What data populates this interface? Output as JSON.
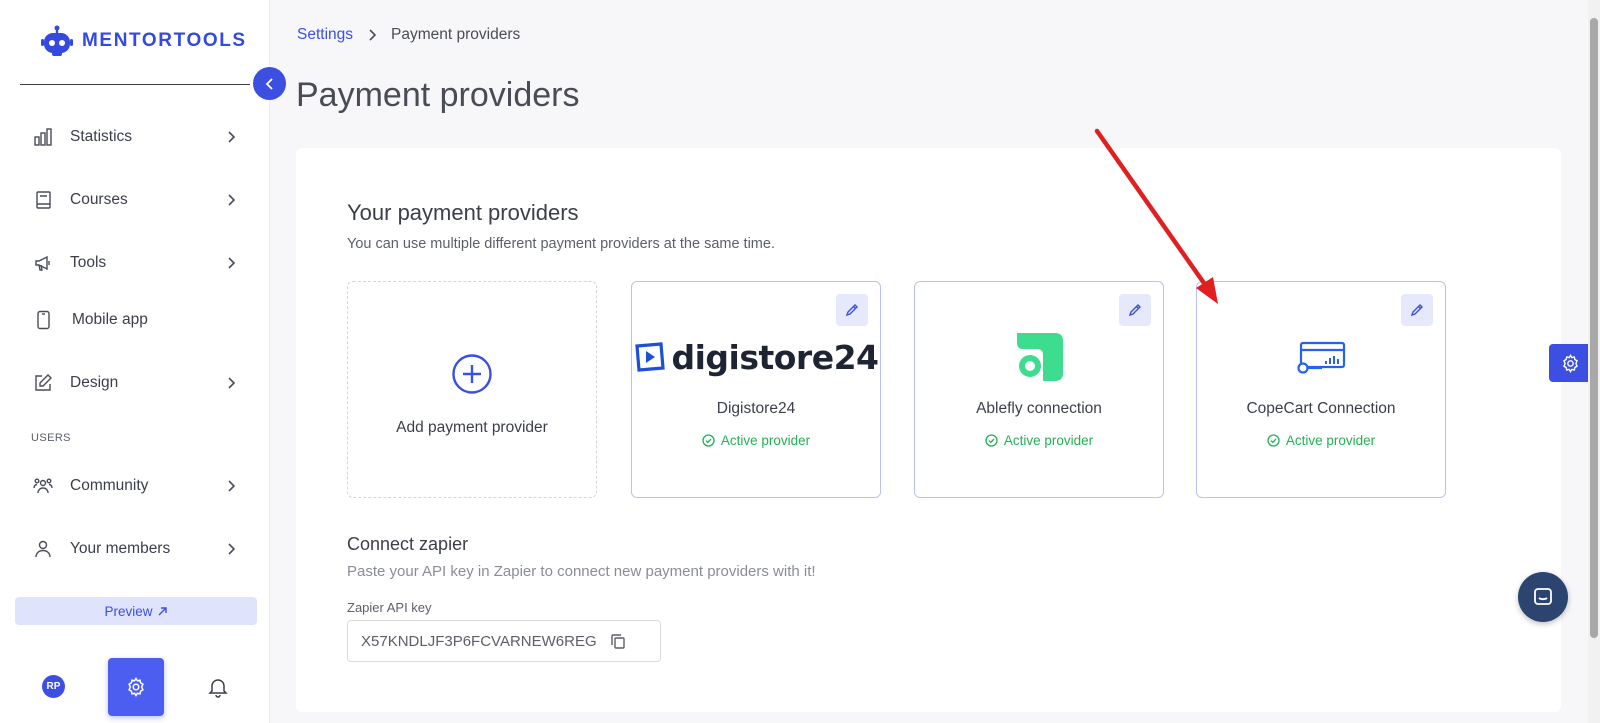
{
  "app": {
    "logo_text": "MENTORTOOLS"
  },
  "sidebar": {
    "items": [
      {
        "label": "Statistics"
      },
      {
        "label": "Courses"
      },
      {
        "label": "Tools"
      },
      {
        "label": "Mobile app"
      },
      {
        "label": "Design"
      },
      {
        "label": "Community"
      },
      {
        "label": "Your members"
      }
    ],
    "section_users": "USERS",
    "preview_label": "Preview",
    "avatar_initials": "RP"
  },
  "breadcrumb": {
    "parent": "Settings",
    "current": "Payment providers"
  },
  "page": {
    "title": "Payment providers"
  },
  "providers_section": {
    "title": "Your payment providers",
    "subtitle": "You can use multiple different payment providers at the same time.",
    "add_label": "Add payment provider",
    "cards": [
      {
        "name": "Digistore24",
        "logo_text": "digistore24",
        "status": "Active provider"
      },
      {
        "name": "Ablefly connection",
        "status": "Active provider"
      },
      {
        "name": "CopeCart Connection",
        "status": "Active provider"
      }
    ]
  },
  "zapier": {
    "title": "Connect zapier",
    "subtitle": "Paste your API key in Zapier to connect new payment providers with it!",
    "field_label": "Zapier API key",
    "api_key": "X57KNDLJF3P6FCVARNEW6REG"
  },
  "colors": {
    "accent": "#3c4fe0",
    "success": "#22b155",
    "annotation_arrow": "#e02020",
    "ablefly_green": "#3ddc8f"
  }
}
